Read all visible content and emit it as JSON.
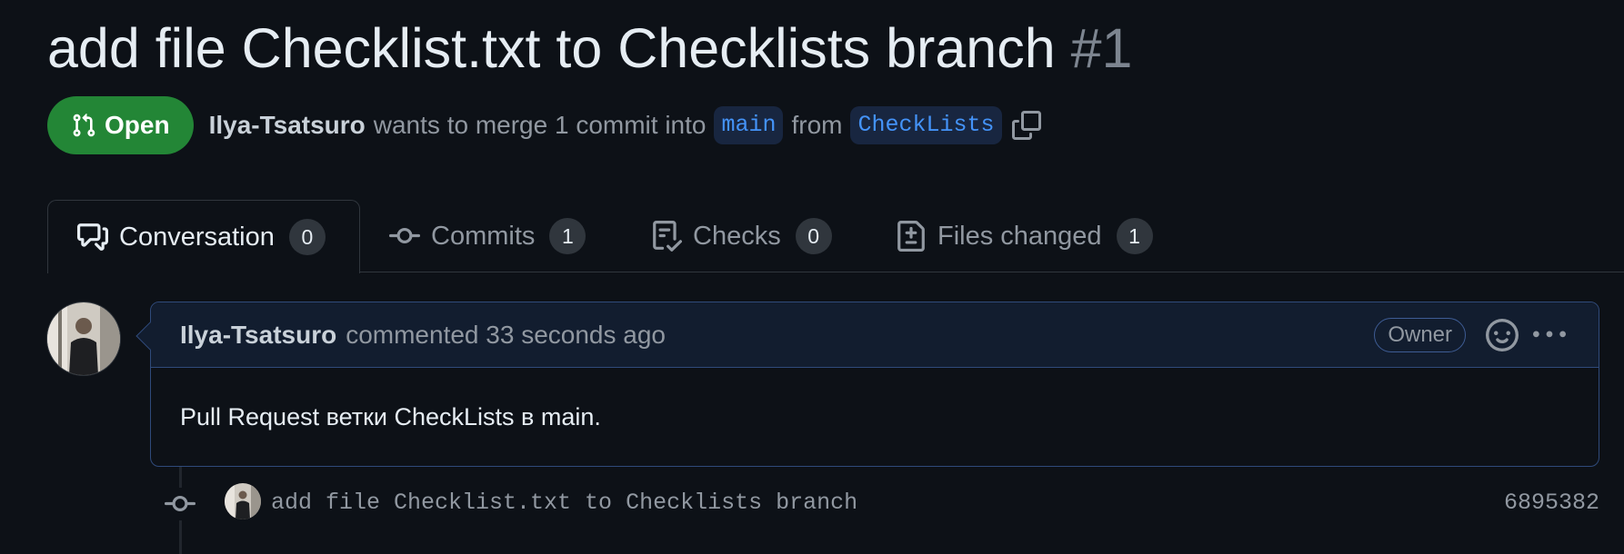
{
  "pull_request": {
    "title": "add file Checklist.txt to Checklists branch",
    "number": "#1",
    "state": "Open",
    "author": "Ilya-Tsatsuro",
    "merge_text_1": "wants to merge 1 commit into",
    "base_branch": "main",
    "merge_text_2": "from",
    "head_branch": "CheckLists"
  },
  "tabs": [
    {
      "label": "Conversation",
      "count": "0",
      "icon": "comment-discussion-icon",
      "active": true
    },
    {
      "label": "Commits",
      "count": "1",
      "icon": "git-commit-icon"
    },
    {
      "label": "Checks",
      "count": "0",
      "icon": "checklist-icon"
    },
    {
      "label": "Files changed",
      "count": "1",
      "icon": "file-diff-icon"
    }
  ],
  "comment": {
    "author": "Ilya-Tsatsuro",
    "meta": "commented 33 seconds ago",
    "role_badge": "Owner",
    "body": "Pull Request ветки CheckLists в main."
  },
  "commit": {
    "message": "add file Checklist.txt to Checklists branch",
    "sha": "6895382"
  },
  "colors": {
    "background": "#0d1117",
    "open_badge": "#238636",
    "branch_text": "#4493f8",
    "comment_border": "#2f4a7a",
    "comment_header_bg": "#121d2f"
  }
}
